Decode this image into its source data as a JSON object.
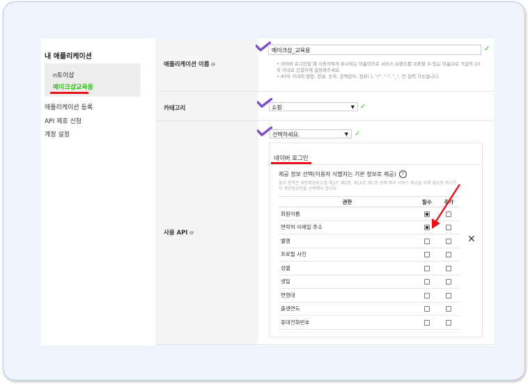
{
  "nav": {
    "title": "내 애플리케이션",
    "apps": [
      "n토이샵",
      "메이크샵교육용"
    ],
    "links": [
      "애플리케이션 등록",
      "API 제휴 신청",
      "계정 설정"
    ]
  },
  "form": {
    "app_name": {
      "label": "애플리케이션 이름",
      "link_icon": "⊖",
      "value": "메이크샵_교육용",
      "notes": [
        "네이버 로그인할 때 사용자에게 표시되는 이름이므로 서비스 브랜드를 대표할 수 있는 이름으로 가급적 10자 이내로 간결하게 설정해주세요.",
        "40자 이내의 영문, 한글, 숫자, 공백문자, 점표(.), \"/\", \"-\", \"_\", 만 입력 가능합니다."
      ]
    },
    "category": {
      "label": "카테고리",
      "value": "쇼핑"
    },
    "api": {
      "label": "사용 API",
      "link_icon": "⊖",
      "select_value": "선택하세요.",
      "tab": "네이버 로그인",
      "provide_title": "제공 정보 선택(이용자 식별자는 기본 정보로 제공)",
      "help_icon": "?",
      "provide_note": "필수 항목은 개인정보보호법 제3조 제1항, 제16조 제1항 등에 따라 서비스 제공을 위해 필요한 최소한의 개인정보만을 선택해야 합니다.",
      "headers": [
        "권한",
        "필수",
        "추가"
      ],
      "rows": [
        {
          "name": "회원이름",
          "required": true,
          "extra": false
        },
        {
          "name": "연락처 이메일 주소",
          "required": true,
          "extra": false
        },
        {
          "name": "별명",
          "required": false,
          "extra": false
        },
        {
          "name": "프로필 사진",
          "required": false,
          "extra": false
        },
        {
          "name": "성별",
          "required": false,
          "extra": false
        },
        {
          "name": "생일",
          "required": false,
          "extra": false
        },
        {
          "name": "연령대",
          "required": false,
          "extra": false
        },
        {
          "name": "출생연도",
          "required": false,
          "extra": false
        },
        {
          "name": "휴대전화번호",
          "required": false,
          "extra": false
        }
      ],
      "close": "✕"
    }
  },
  "colors": {
    "accent_green": "#1ec800",
    "annotation_red": "#e8121a",
    "annotation_purple": "#7b4fc7"
  },
  "icons": {
    "check": "check-icon",
    "link": "link-icon",
    "dropdown": "triangle-down-icon"
  }
}
